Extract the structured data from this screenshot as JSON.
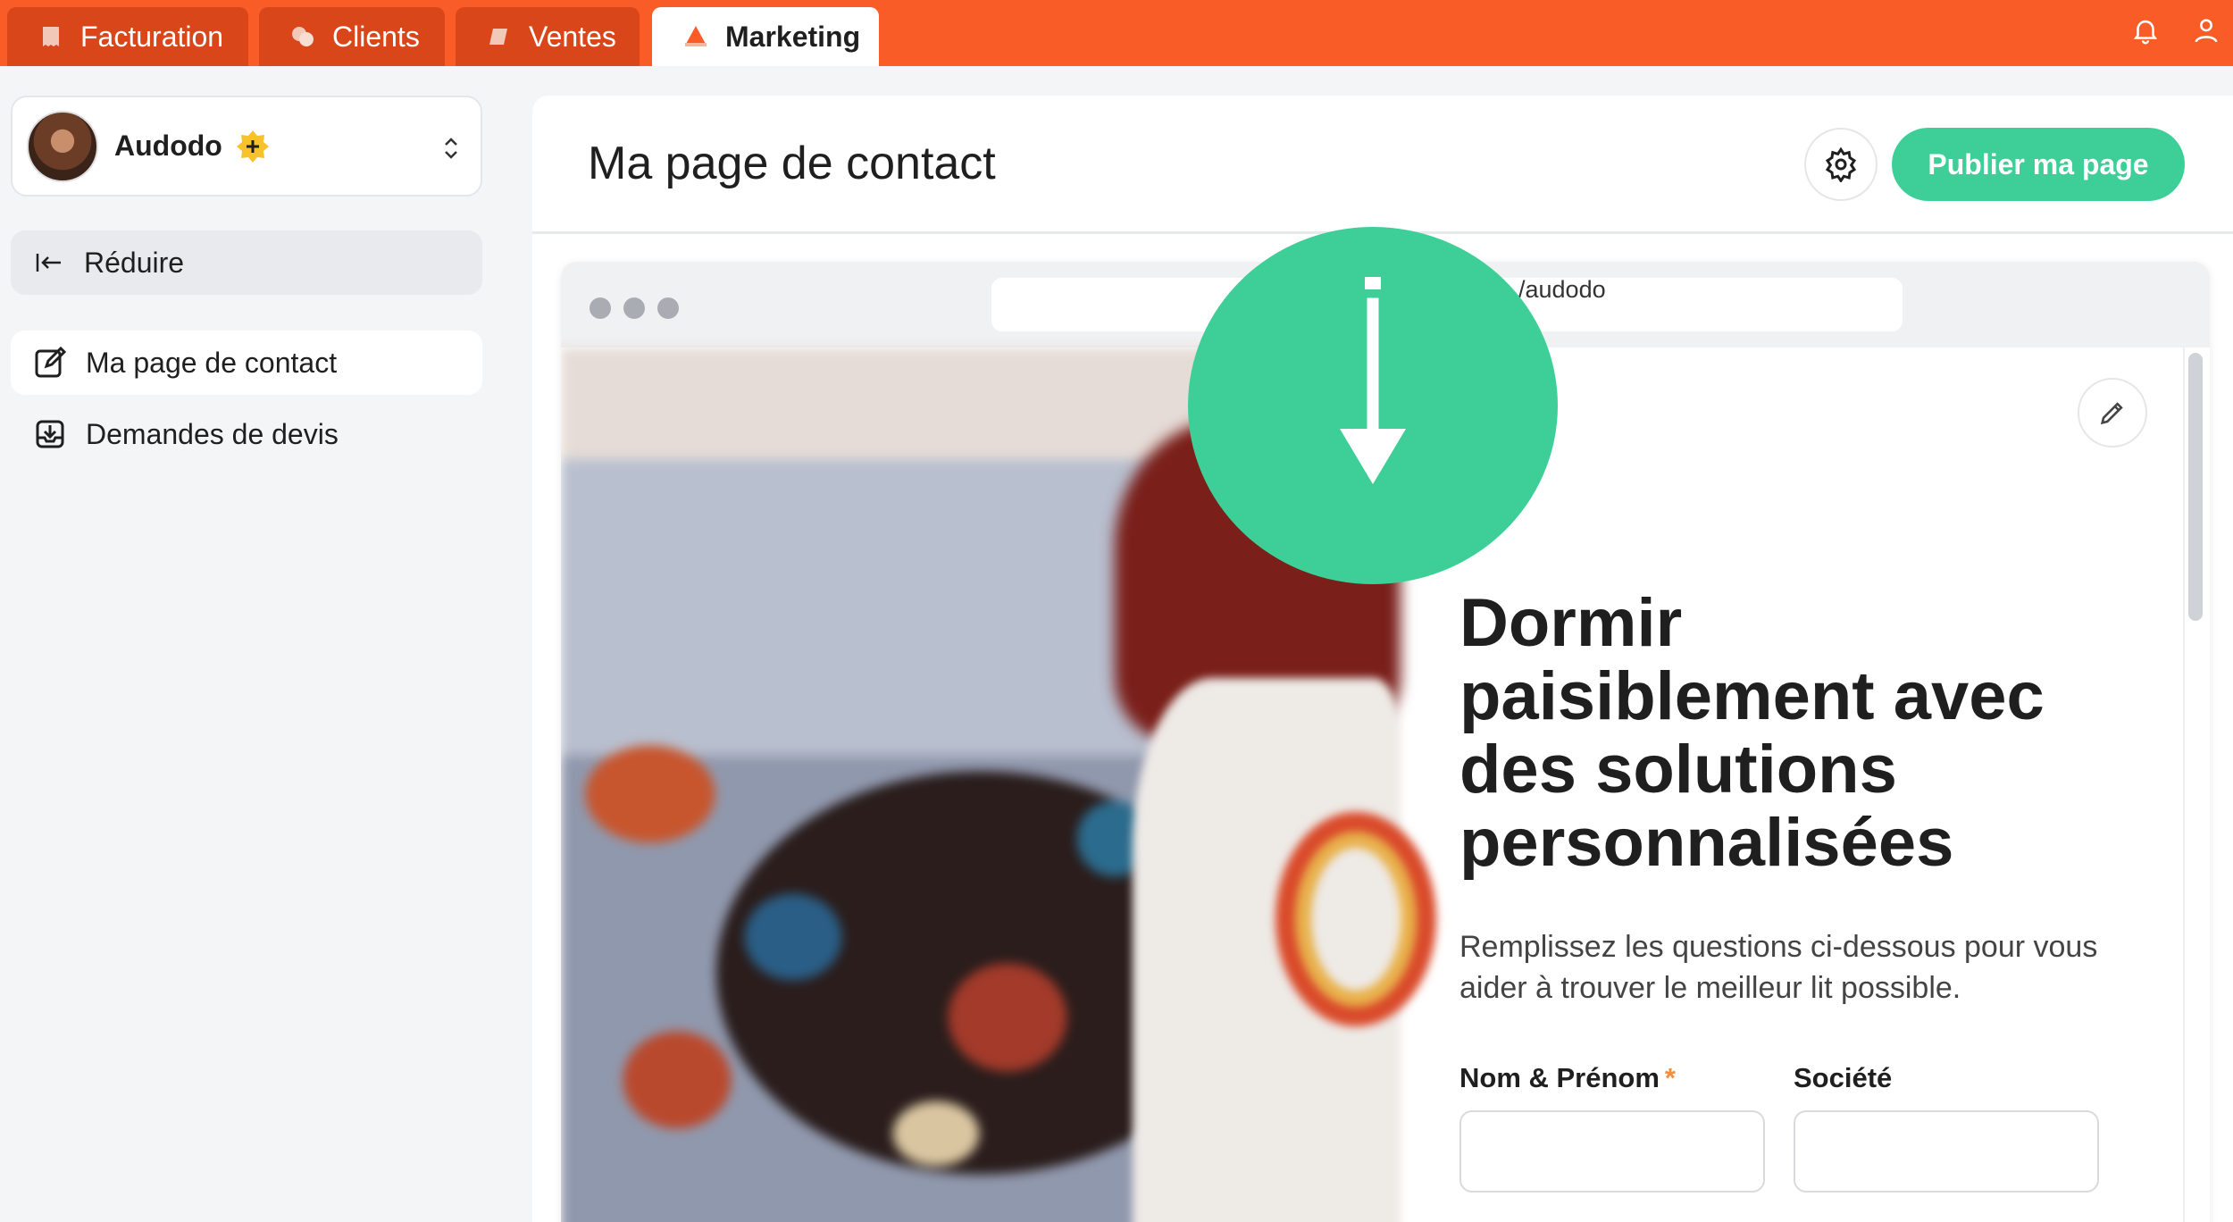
{
  "tabs": [
    {
      "label": "Facturation",
      "icon": "invoice-icon"
    },
    {
      "label": "Clients",
      "icon": "clients-icon"
    },
    {
      "label": "Ventes",
      "icon": "sales-icon"
    },
    {
      "label": "Marketing",
      "icon": "marketing-icon",
      "active": true
    }
  ],
  "topbar": {
    "notification_icon": "bell-icon",
    "user_icon": "user-icon"
  },
  "sidebar": {
    "account_name": "Audodo",
    "collapse_label": "Réduire",
    "items": [
      {
        "label": "Ma page de contact",
        "icon": "edit-page-icon",
        "active": true
      },
      {
        "label": "Demandes de devis",
        "icon": "inbox-download-icon"
      }
    ]
  },
  "header": {
    "title": "Ma page de contact",
    "publish_label": "Publier ma page"
  },
  "preview": {
    "url": "/audodo",
    "hero_title": "Dormir paisiblement avec des solutions personnalisées",
    "hero_subtitle": "Remplissez les questions ci-dessous pour vous aider à trouver le meilleur lit possible.",
    "form": {
      "name_label": "Nom & Prénom",
      "required_mark": "*",
      "company_label": "Société"
    }
  },
  "colors": {
    "brand_orange": "#fa5c28",
    "accent_green": "#3ecf98",
    "required_orange": "#fa8c3c"
  }
}
